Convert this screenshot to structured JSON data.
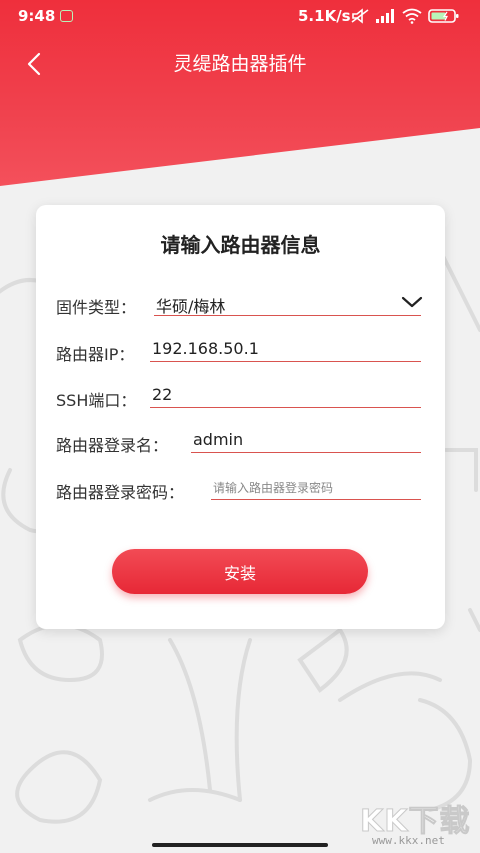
{
  "status_bar": {
    "time": "9:48",
    "network_speed": "5.1K/s"
  },
  "header": {
    "title": "灵缇路由器插件"
  },
  "form": {
    "title": "请输入路由器信息",
    "router_type": {
      "label": "固件类型：",
      "value": "华硕/梅林"
    },
    "router_ip": {
      "label": "路由器IP：",
      "value": "192.168.50.1"
    },
    "ssh_port": {
      "label": "SSH端口：",
      "value": "22"
    },
    "username": {
      "label": "路由器登录名：",
      "value": "admin"
    },
    "password": {
      "label": "路由器登录密码：",
      "value": "",
      "placeholder": "请输入路由器登录密码"
    },
    "install_label": "安装"
  },
  "colors": {
    "accent": "#ef2f3c",
    "underline": "#d9534f"
  },
  "icons": [
    "back-arrow-icon",
    "chevron-down-icon",
    "wifi-icon",
    "battery-icon",
    "signal-icon",
    "mute-icon"
  ]
}
